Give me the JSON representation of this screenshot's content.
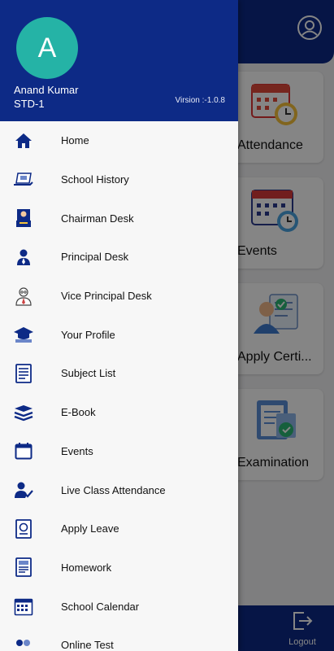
{
  "drawer": {
    "avatar_letter": "A",
    "user_name": "Anand Kumar",
    "user_class": "STD-1",
    "version": "Virsion :-1.0.8",
    "menu": [
      {
        "label": "Home",
        "icon": "home-icon"
      },
      {
        "label": "School History",
        "icon": "laptop-icon"
      },
      {
        "label": "Chairman Desk",
        "icon": "chairman-icon"
      },
      {
        "label": "Principal Desk",
        "icon": "principal-icon"
      },
      {
        "label": "Vice Principal Desk",
        "icon": "vice-principal-icon"
      },
      {
        "label": "Your Profile",
        "icon": "graduation-cap-icon"
      },
      {
        "label": "Subject List",
        "icon": "subject-list-icon"
      },
      {
        "label": "E-Book",
        "icon": "books-icon"
      },
      {
        "label": "Events",
        "icon": "calendar-icon"
      },
      {
        "label": "Live Class Attendance",
        "icon": "attendance-user-icon"
      },
      {
        "label": "Apply Leave",
        "icon": "apply-leave-icon"
      },
      {
        "label": "Homework",
        "icon": "homework-icon"
      },
      {
        "label": "School Calendar",
        "icon": "school-calendar-icon"
      },
      {
        "label": "Online Test",
        "icon": "online-test-icon"
      }
    ]
  },
  "background": {
    "tiles": [
      {
        "label": "Attendance"
      },
      {
        "label": "Events"
      },
      {
        "label": "Apply Certi..."
      },
      {
        "label": "Examination"
      }
    ],
    "logout_label": "Logout"
  },
  "colors": {
    "primary": "#0d2a86",
    "avatar": "#25b3a6",
    "drawer_bg": "#f7f7f7"
  }
}
